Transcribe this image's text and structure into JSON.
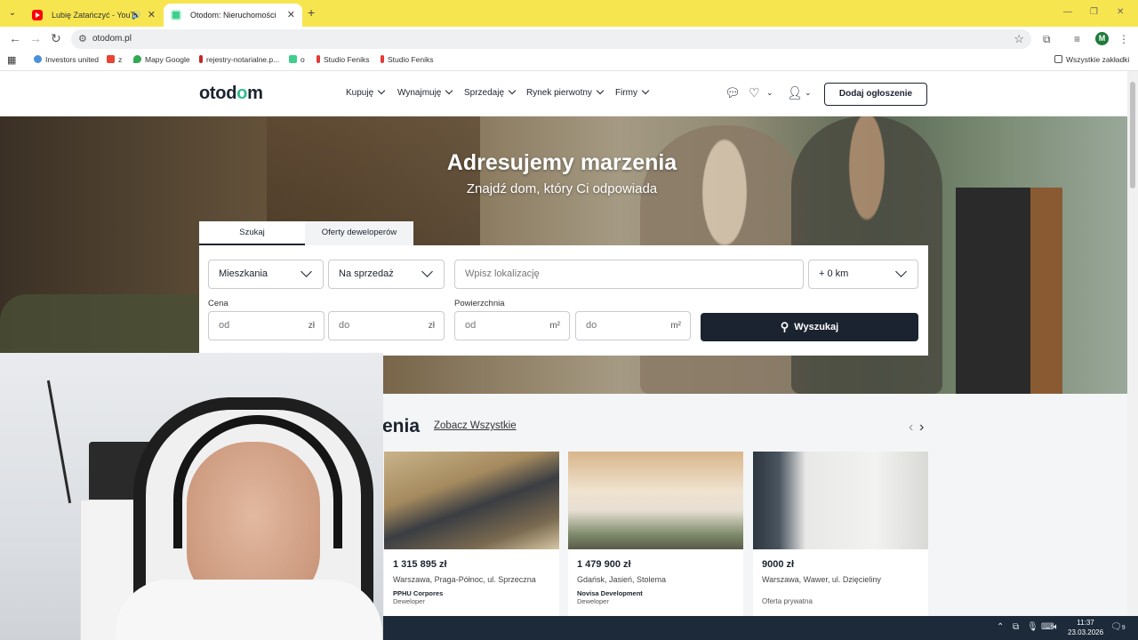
{
  "browser": {
    "tabs": [
      {
        "title": "Lubię Zatańczyć - YouTube",
        "active": false
      },
      {
        "title": "Otodom: Nieruchomości, Miesz",
        "active": true
      }
    ],
    "url": "otodom.pl",
    "profile_initial": "M",
    "bookmarks": [
      "Investors united",
      "z",
      "Mapy Google",
      "rejestry-notarialne.p...",
      "o",
      "Studio Feniks",
      "Studio Feniks"
    ],
    "all_bookmarks": "Wszystkie zakładki"
  },
  "site": {
    "logo": "otodom",
    "nav": [
      "Kupuję",
      "Wynajmuję",
      "Sprzedaję",
      "Rynek pierwotny",
      "Firmy"
    ],
    "add_listing": "Dodaj ogłoszenie"
  },
  "hero": {
    "title": "Adresujemy marzenia",
    "subtitle": "Znajdź dom, który Ci odpowiada"
  },
  "search": {
    "tabs": [
      "Szukaj",
      "Oferty deweloperów"
    ],
    "property_type": "Mieszkania",
    "transaction": "Na sprzedaż",
    "location_placeholder": "Wpisz lokalizację",
    "radius": "+ 0 km",
    "price_label": "Cena",
    "area_label": "Powierzchnia",
    "from": "od",
    "to": "do",
    "currency": "zł",
    "area_unit": "m²",
    "button": "Wyszukaj"
  },
  "listings": {
    "section_title": "enia",
    "see_all": "Zobacz Wszystkie",
    "cards": [
      {
        "price": "1 315 895 zł",
        "address": "Warszawa, Praga-Północ, ul. Sprzeczna",
        "developer": "PPHU Corpores",
        "type": "Deweloper"
      },
      {
        "price": "1 479 900 zł",
        "address": "Gdańsk, Jasień, Stolema",
        "developer": "Novisa Development",
        "type": "Deweloper"
      },
      {
        "price": "9000 zł",
        "address": "Warszawa, Wawer, ul. Dzięcieliny",
        "developer": "",
        "type": "Oferta prywatna"
      }
    ]
  },
  "taskbar": {
    "time": "11:37",
    "date": "23.03.2026",
    "notifications": "9"
  },
  "colors": {
    "tabbar": "#f6e54f",
    "brand_dark": "#1b2330",
    "brand_green": "#2dc089"
  }
}
